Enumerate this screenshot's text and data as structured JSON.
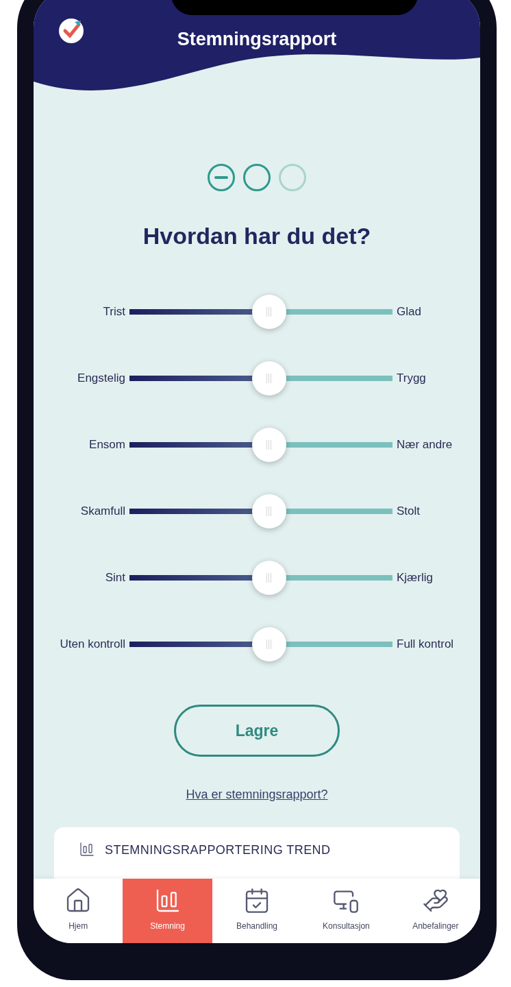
{
  "header": {
    "title": "Stemningsrapport"
  },
  "steps": [
    {
      "kind": "current"
    },
    {
      "kind": "next"
    },
    {
      "kind": "upcoming"
    }
  ],
  "question": "Hvordan har du det?",
  "sliders": [
    {
      "left": "Trist",
      "right": "Glad",
      "level": 0.53
    },
    {
      "left": "Engstelig",
      "right": "Trygg",
      "level": 0.53
    },
    {
      "left": "Ensom",
      "right": "Nær andre",
      "level": 0.53
    },
    {
      "left": "Skamfull",
      "right": "Stolt",
      "level": 0.53
    },
    {
      "left": "Sint",
      "right": "Kjærlig",
      "level": 0.53
    },
    {
      "left": "Uten kontroll",
      "right": "Full kontrol",
      "level": 0.53
    }
  ],
  "save_button": "Lagre",
  "help_link": "Hva er stemningsrapport?",
  "trend_card": {
    "title": "STEMNINGSRAPPORTERING TREND"
  },
  "nav": [
    {
      "kind": "home",
      "label": "Hjem",
      "selected": false
    },
    {
      "kind": "chart",
      "label": "Stemning",
      "selected": true
    },
    {
      "kind": "calendar",
      "label": "Behandling",
      "selected": false
    },
    {
      "kind": "monitor",
      "label": "Konsultasjon",
      "selected": false
    },
    {
      "kind": "care",
      "label": "Anbefalinger",
      "selected": false
    }
  ]
}
